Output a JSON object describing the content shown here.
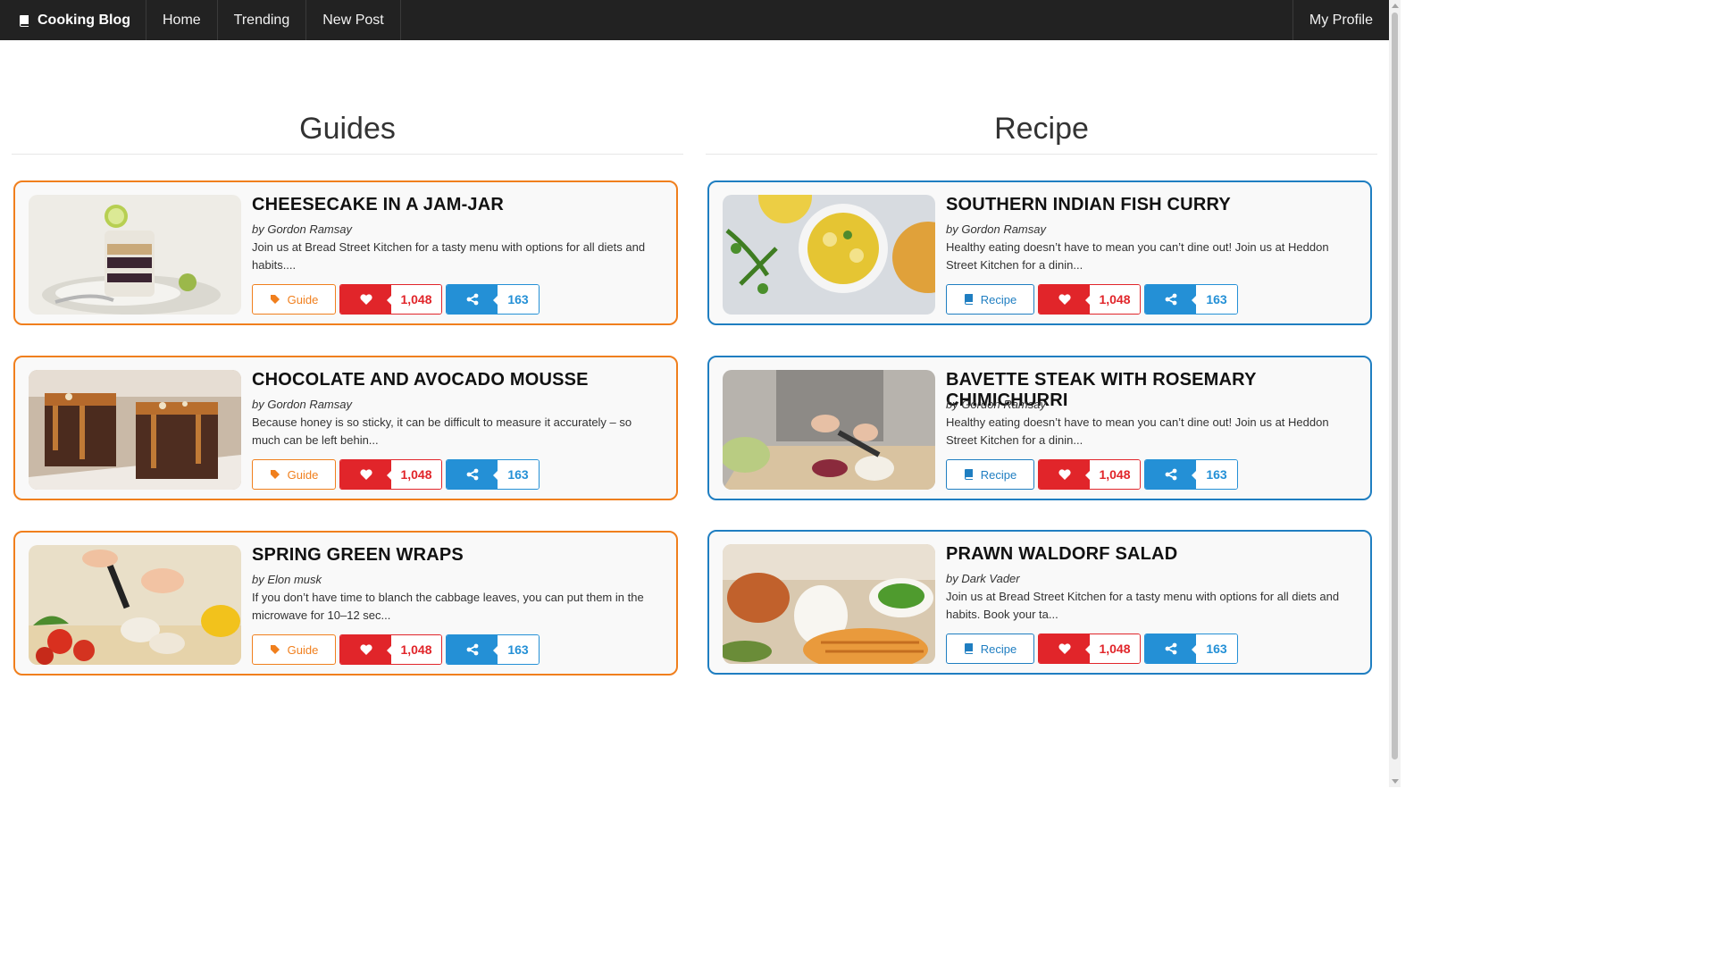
{
  "nav": {
    "brand": "Cooking Blog",
    "links": [
      "Home",
      "Trending",
      "New Post"
    ],
    "profile": "My Profile"
  },
  "guides": {
    "heading": "Guides",
    "tag_label": "Guide",
    "accent": "#f07f1d",
    "cards": [
      {
        "title": "CHEESECAKE IN A JAM-JAR",
        "author": "by Gordon Ramsay",
        "desc": "Join us at Bread Street Kitchen for a tasty menu with options for all diets and habits....",
        "likes": "1,048",
        "shares": "163"
      },
      {
        "title": "CHOCOLATE AND AVOCADO MOUSSE",
        "author": "by Gordon Ramsay",
        "desc": "Because honey is so sticky, it can be difficult to measure it accurately – so much can be left behin...",
        "likes": "1,048",
        "shares": "163"
      },
      {
        "title": "SPRING GREEN WRAPS",
        "author": "by Elon musk",
        "desc": "If you don’t have time to blanch the cabbage leaves, you can put them in the microwave for 10–12 sec...",
        "likes": "1,048",
        "shares": "163"
      }
    ]
  },
  "recipes": {
    "heading": "Recipe",
    "tag_label": "Recipe",
    "accent": "#1f7ec1",
    "cards": [
      {
        "title": "SOUTHERN INDIAN FISH CURRY",
        "author": "by Gordon Ramsay",
        "desc": "Healthy eating doesn’t have to mean you can’t dine out! Join us at Heddon Street Kitchen for a dinin...",
        "likes": "1,048",
        "shares": "163"
      },
      {
        "title": "BAVETTE STEAK WITH ROSEMARY CHIMICHURRI",
        "author": "by Gordon Ramsay",
        "desc": "Healthy eating doesn’t have to mean you can’t dine out! Join us at Heddon Street Kitchen for a dinin...",
        "likes": "1,048",
        "shares": "163"
      },
      {
        "title": "PRAWN WALDORF SALAD",
        "author": "by Dark Vader",
        "desc": "Join us at Bread Street Kitchen for a tasty menu with options for all diets and habits. Book your ta...",
        "likes": "1,048",
        "shares": "163"
      }
    ]
  },
  "colors": {
    "like": "#e1252a",
    "share": "#2490d6",
    "navbar": "#222222"
  }
}
